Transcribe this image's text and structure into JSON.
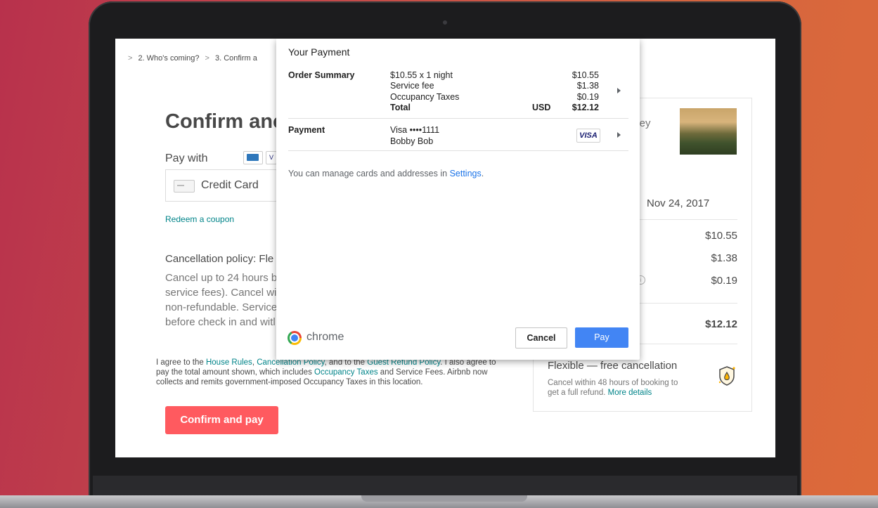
{
  "page": {
    "breadcrumb": {
      "step2": "2. Who's coming?",
      "step3": "3. Confirm a"
    },
    "heading": "Confirm anc",
    "pay_with": "Pay with",
    "card_icon_partial": "V",
    "payment_select": "Credit Card",
    "redeem_coupon": "Redeem a coupon",
    "cancellation_title": "Cancellation policy: Fle",
    "cancellation_lines": [
      "Cancel up to 24 hours b",
      "service fees). Cancel wit",
      "non-refundable. Service",
      "before check in and witl"
    ],
    "agreement": {
      "t1": "I agree to the ",
      "house_rules": "House Rules",
      "t2": ", ",
      "cancellation_policy": "Cancellation Policy",
      "t3": ", and to the ",
      "guest_refund": "Guest Refund Policy",
      "t4": ". I also agree to pay the total amount shown, which includes ",
      "occupancy_taxes": "Occupancy Taxes",
      "t5": " and Service Fees. Airbnb now collects and remits government-imposed Occupancy Taxes in this location."
    },
    "confirm_button": "Confirm and pay"
  },
  "summary_card": {
    "listing_title_partial": "lley",
    "date": "Nov 24, 2017",
    "prices": [
      "$10.55",
      "$1.38",
      "$0.19"
    ],
    "total": "$12.12",
    "flexible_title": "Flexible — free cancellation",
    "flexible_body": "Cancel within 48 hours of booking to get a full refund. ",
    "more_details": "More details"
  },
  "payment_sheet": {
    "title": "Your Payment",
    "order_summary_label": "Order Summary",
    "items": [
      {
        "label": "$10.55 x 1 night",
        "amount": "$10.55"
      },
      {
        "label": "Service fee",
        "amount": "$1.38"
      },
      {
        "label": "Occupancy Taxes",
        "amount": "$0.19"
      }
    ],
    "total_label": "Total",
    "currency": "USD",
    "total_amount": "$12.12",
    "payment_label": "Payment",
    "card": "Visa ••••1111",
    "cardholder": "Bobby Bob",
    "card_brand": "VISA",
    "manage_text": "You can manage cards and addresses in ",
    "settings_link": "Settings",
    "manage_end": ".",
    "browser": "chrome",
    "cancel_button": "Cancel",
    "pay_button": "Pay"
  },
  "colors": {
    "accent": "#ff5a5f",
    "link": "#008489",
    "pay": "#4285f4"
  }
}
